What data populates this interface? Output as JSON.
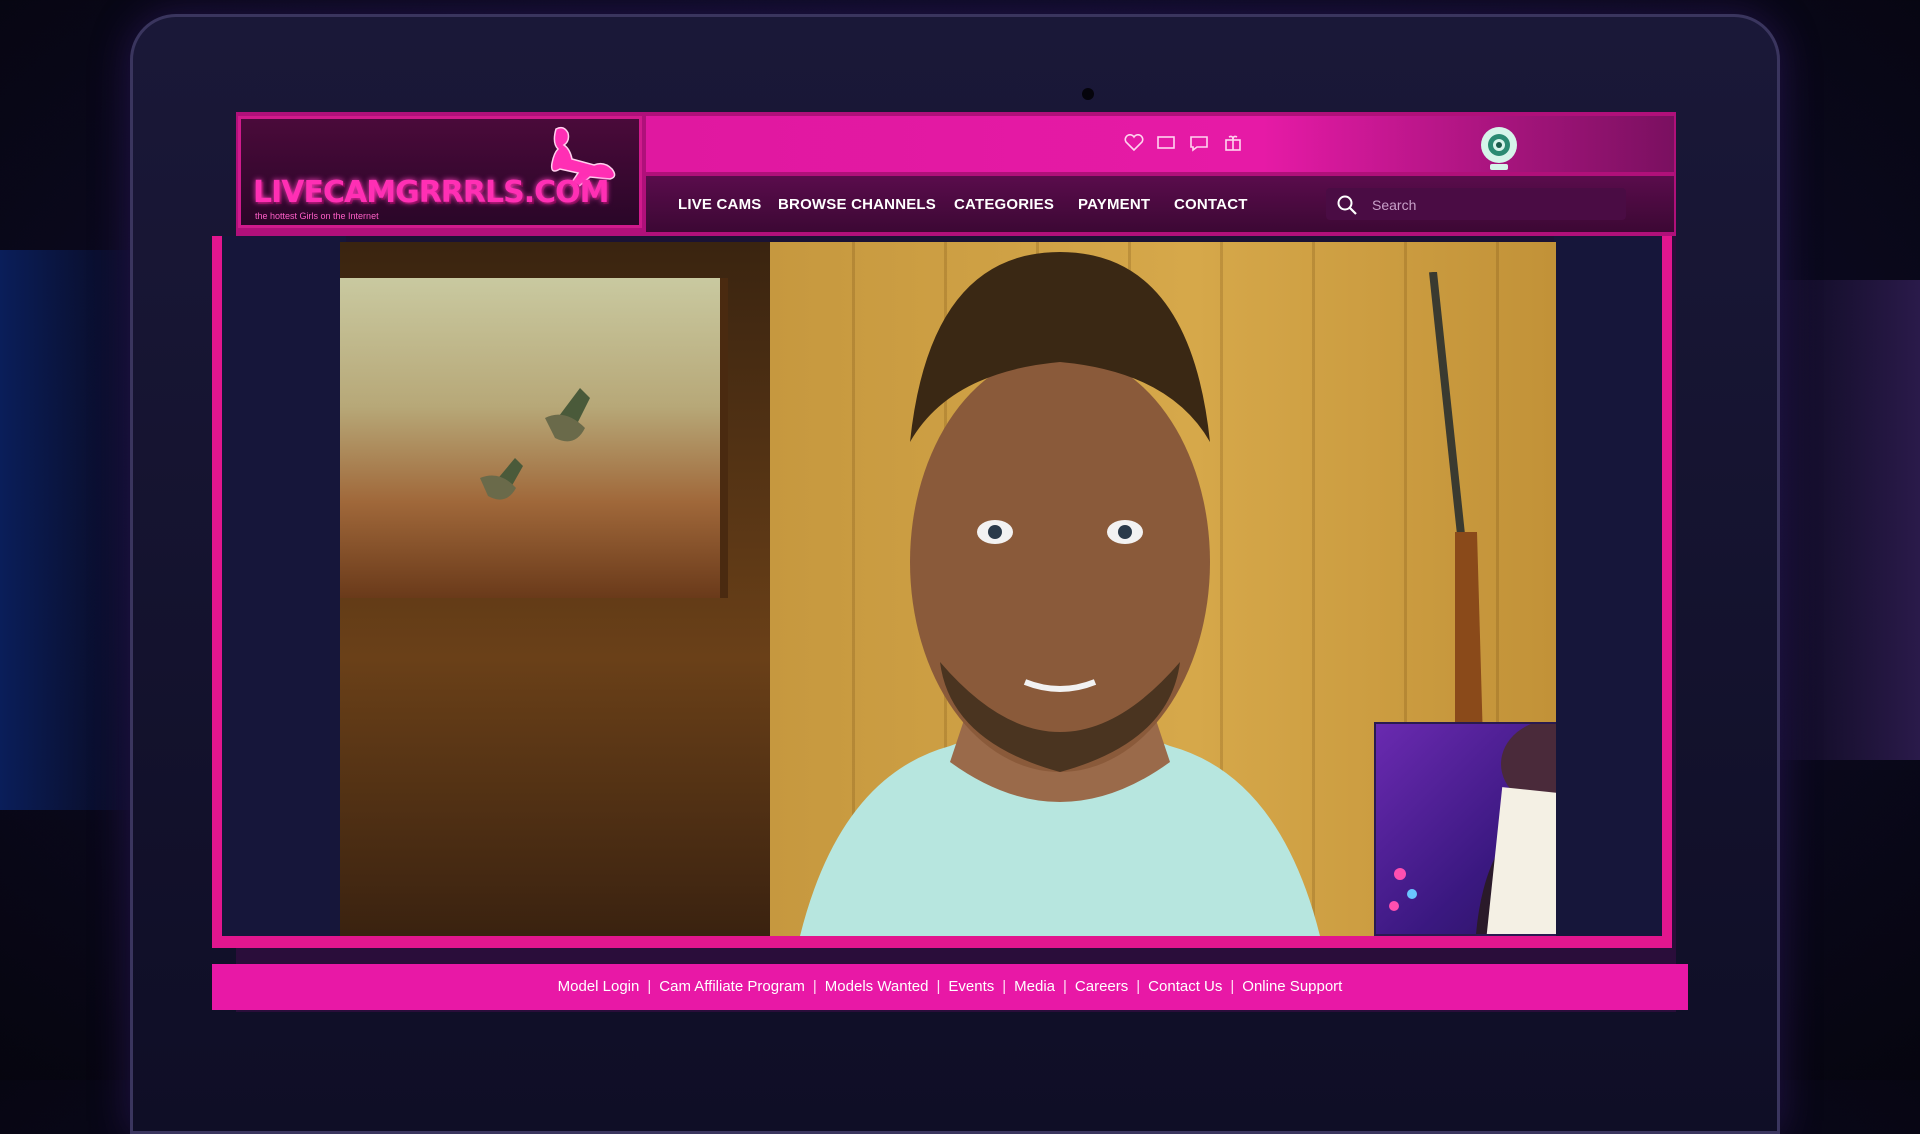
{
  "site": {
    "logo_text": "LIVECAMGRRRLS.COM",
    "tagline": "the hottest Girls on the Internet"
  },
  "nav": {
    "items": [
      {
        "label": "LIVE CAMS"
      },
      {
        "label": "BROWSE CHANNELS"
      },
      {
        "label": "CATEGORIES"
      },
      {
        "label": "PAYMENT"
      },
      {
        "label": "CONTACT"
      }
    ]
  },
  "top_icons": [
    "heart-icon",
    "message-icon",
    "chat-icon",
    "gift-icon",
    "webcam-icon"
  ],
  "search": {
    "placeholder": "Search"
  },
  "footer": {
    "links": [
      {
        "label": "Model Login"
      },
      {
        "label": "Cam Affiliate Program"
      },
      {
        "label": "Models Wanted"
      },
      {
        "label": "Events"
      },
      {
        "label": "Media"
      },
      {
        "label": "Careers"
      },
      {
        "label": "Contact Us"
      },
      {
        "label": "Online Support"
      }
    ],
    "separator": "|"
  },
  "colors": {
    "accent": "#e818a6",
    "nav_bg": "#4a0a40",
    "page_bg": "#0c0a22"
  }
}
